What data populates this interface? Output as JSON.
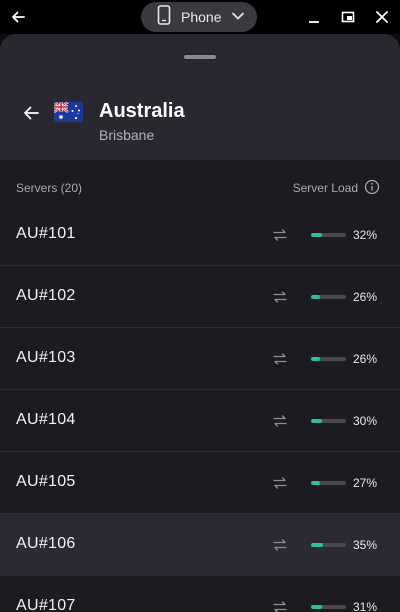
{
  "titlebar": {
    "device_label": "Phone",
    "icons": {
      "back": "arrow-left-icon",
      "device": "phone-icon",
      "dropdown": "chevron-down-icon",
      "minimize": "minimize-icon",
      "restore": "restore-icon",
      "close": "close-icon"
    }
  },
  "header": {
    "country": "Australia",
    "city": "Brisbane",
    "flag": "australia-flag-icon"
  },
  "list": {
    "servers_label": "Servers (20)",
    "load_label": "Server Load"
  },
  "servers": [
    {
      "name": "AU#101",
      "load": "32%",
      "load_value": 0.32
    },
    {
      "name": "AU#102",
      "load": "26%",
      "load_value": 0.26
    },
    {
      "name": "AU#103",
      "load": "26%",
      "load_value": 0.26
    },
    {
      "name": "AU#104",
      "load": "30%",
      "load_value": 0.3
    },
    {
      "name": "AU#105",
      "load": "27%",
      "load_value": 0.27
    },
    {
      "name": "AU#106",
      "load": "35%",
      "load_value": 0.35,
      "highlighted": true
    },
    {
      "name": "AU#107",
      "load": "31%",
      "load_value": 0.31
    }
  ],
  "colors": {
    "accent": "#2fbf9c",
    "sheet_bg": "#1c1b22",
    "header_bg": "#292831",
    "highlight_row": "#2b2a32"
  }
}
